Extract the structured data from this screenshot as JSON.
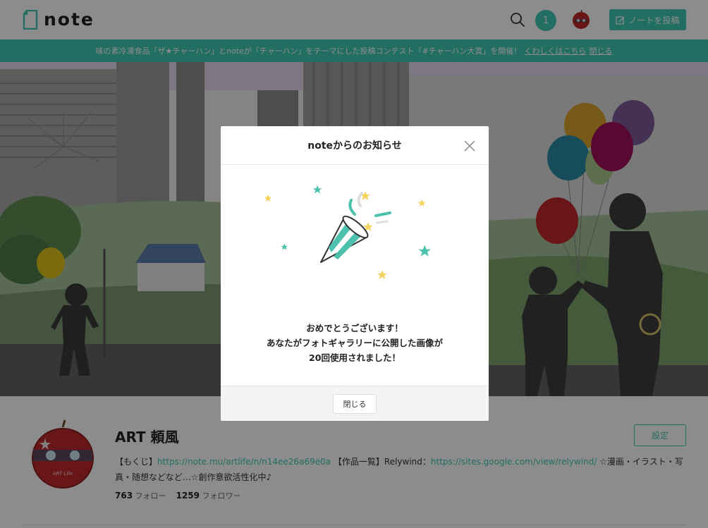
{
  "header": {
    "logo_text": "note",
    "notification_count": "1",
    "post_button_label": "ノートを投稿"
  },
  "banner": {
    "text": "味の素冷凍食品「ザ★チャーハン」とnoteが「チャーハン」をテーマにした投稿コンテスト「#チャーハン大賞」を開催！",
    "details_link": "くわしくはこちら",
    "close_link": "閉じる"
  },
  "profile": {
    "name": "ART 頼風",
    "avatar_label": "ART Life",
    "settings_label": "設定",
    "bio_prefix": "【もくじ】",
    "bio_link1": "https://note.mu/artlife/n/n14ee26a69e0a",
    "bio_mid": " 【作品一覧】Relywind：",
    "bio_link2": "https://sites.google.com/view/relywind/",
    "bio_suffix": " ☆漫画・イラスト・写真・随想などなど…☆創作意欲活性化中♪",
    "follow_count": "763",
    "follow_label": "フォロー",
    "follower_count": "1259",
    "follower_label": "フォロワー"
  },
  "modal": {
    "title": "noteからのお知らせ",
    "message_line1": "おめでとうございます！",
    "message_line2": "あなたがフォトギャラリーに公開した画像が",
    "message_line3": "20回使用されました！",
    "close_button": "閉じる"
  },
  "colors": {
    "accent": "#41c9b4",
    "star_yellow": "#f4d35e",
    "balloon_red": "#c0282c"
  }
}
